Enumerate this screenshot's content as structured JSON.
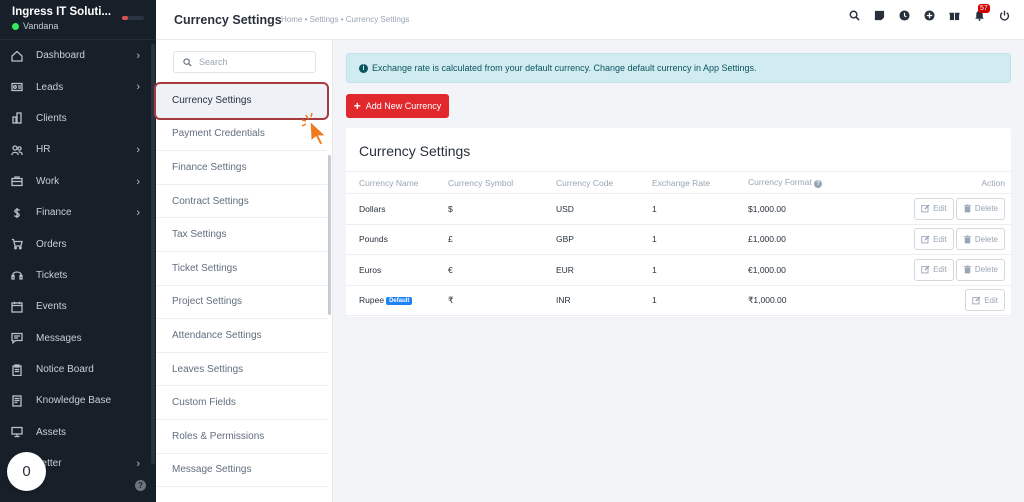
{
  "brand": {
    "name": "Ingress IT Soluti...",
    "user": "Vandana"
  },
  "sidebar": {
    "items": [
      {
        "label": "Dashboard",
        "icon": "home-icon",
        "chevron": true
      },
      {
        "label": "Leads",
        "icon": "id-card-icon",
        "chevron": true
      },
      {
        "label": "Clients",
        "icon": "building-icon",
        "chevron": false
      },
      {
        "label": "HR",
        "icon": "people-icon",
        "chevron": true
      },
      {
        "label": "Work",
        "icon": "briefcase-icon",
        "chevron": true
      },
      {
        "label": "Finance",
        "icon": "dollar-icon",
        "chevron": true
      },
      {
        "label": "Orders",
        "icon": "cart-icon",
        "chevron": false
      },
      {
        "label": "Tickets",
        "icon": "headset-icon",
        "chevron": false
      },
      {
        "label": "Events",
        "icon": "calendar-icon",
        "chevron": false
      },
      {
        "label": "Messages",
        "icon": "chat-icon",
        "chevron": false
      },
      {
        "label": "Notice Board",
        "icon": "clipboard-icon",
        "chevron": false
      },
      {
        "label": "Knowledge Base",
        "icon": "book-icon",
        "chevron": false
      },
      {
        "label": "Assets",
        "icon": "monitor-icon",
        "chevron": false
      },
      {
        "label": "Letter",
        "icon": "letter-icon",
        "chevron": true
      }
    ],
    "chevron_glyph": "›",
    "help_glyph": "?",
    "floating_badge": "0"
  },
  "header": {
    "title": "Currency Settings",
    "breadcrumb": "Home • Settings • Currency Settings",
    "notification_count": "57"
  },
  "settings_menu": {
    "search_placeholder": "Search",
    "items": [
      "Currency Settings",
      "Payment Credentials",
      "Finance Settings",
      "Contract Settings",
      "Tax Settings",
      "Ticket Settings",
      "Project Settings",
      "Attendance Settings",
      "Leaves Settings",
      "Custom Fields",
      "Roles & Permissions",
      "Message Settings"
    ],
    "active_index": 0
  },
  "content": {
    "info_text": "Exchange rate is calculated from your default currency. Change default currency in App Settings.",
    "add_button_label": "Add New Currency",
    "card_title": "Currency Settings",
    "columns": [
      "Currency Name",
      "Currency Symbol",
      "Currency Code",
      "Exchange Rate",
      "Currency Format",
      "Action"
    ],
    "default_badge": "Default",
    "edit_label": "Edit",
    "delete_label": "Delete",
    "rows": [
      {
        "name": "Dollars",
        "symbol": "$",
        "code": "USD",
        "rate": "1",
        "format": "$1,000.00",
        "is_default": false
      },
      {
        "name": "Pounds",
        "symbol": "£",
        "code": "GBP",
        "rate": "1",
        "format": "£1,000.00",
        "is_default": false
      },
      {
        "name": "Euros",
        "symbol": "€",
        "code": "EUR",
        "rate": "1",
        "format": "€1,000.00",
        "is_default": false
      },
      {
        "name": "Rupee",
        "symbol": "₹",
        "code": "INR",
        "rate": "1",
        "format": "₹1,000.00",
        "is_default": true
      }
    ]
  },
  "colors": {
    "sidebar_bg": "#171f29",
    "primary_red": "#e0282d",
    "badge_blue": "#1d82f5",
    "highlight_ring": "#a63a3f"
  }
}
